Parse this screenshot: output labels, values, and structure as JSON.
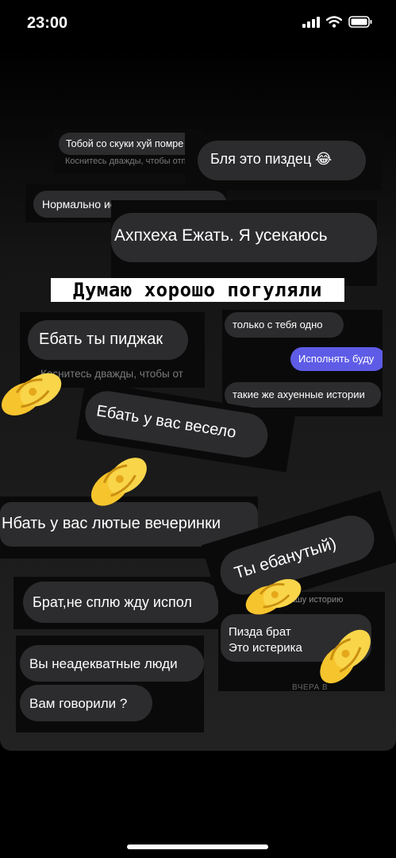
{
  "status_bar": {
    "time": "23:00"
  },
  "overlay_title": "Думаю хорошо погуляли",
  "messages": {
    "m1": "Тобой со скуки хуй помре",
    "m1_hint": "Коснитесь дважды, чтобы отправит",
    "m2": "Бля это пиздец 😂",
    "m3": "Нормально исполняют паца",
    "m4": "Ахпхеха Ежать. Я усекаюсь",
    "m5": "Ебать ты пиджак",
    "m5_hint": "Коснитесь дважды, чтобы от",
    "m6": "только с тебя одно",
    "m7": "Исполнять буду",
    "m8": "такие же ахуенные истории",
    "m9": "Ебать у вас весело",
    "m10": "Нбать у вас лютые вечеринки",
    "m11": "Ты ебанутый)",
    "m12": "Брат,не сплю жду испол",
    "m13_top": "вашу историю",
    "m13_line1": "Пизда брат",
    "m13_line2": "Это истерика",
    "m13_footer": "ВЧЕРА В",
    "m14": "Вы неадекватные люди",
    "m15": "Вам говорили ?"
  },
  "colors": {
    "bubble": "#2c2c2e",
    "accent_purple": "#5e5ce6",
    "emoji_yellow": "#f6c42d"
  },
  "icons": [
    "signal-icon",
    "wifi-icon",
    "battery-icon",
    "handshake-icon"
  ]
}
